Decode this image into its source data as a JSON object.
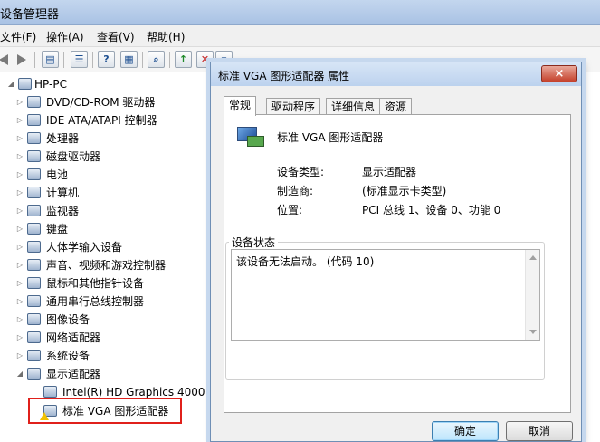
{
  "window": {
    "title": "设备管理器"
  },
  "menu": [
    "文件(F)",
    "操作(A)",
    "查看(V)",
    "帮助(H)"
  ],
  "tree": {
    "root": "HP-PC",
    "items": [
      {
        "label": "DVD/CD-ROM 驱动器",
        "expanded": false
      },
      {
        "label": "IDE ATA/ATAPI 控制器",
        "expanded": false
      },
      {
        "label": "处理器",
        "expanded": false
      },
      {
        "label": "磁盘驱动器",
        "expanded": false
      },
      {
        "label": "电池",
        "expanded": false
      },
      {
        "label": "计算机",
        "expanded": false
      },
      {
        "label": "监视器",
        "expanded": false
      },
      {
        "label": "键盘",
        "expanded": false
      },
      {
        "label": "人体学输入设备",
        "expanded": false
      },
      {
        "label": "声音、视频和游戏控制器",
        "expanded": false
      },
      {
        "label": "鼠标和其他指针设备",
        "expanded": false
      },
      {
        "label": "通用串行总线控制器",
        "expanded": false
      },
      {
        "label": "图像设备",
        "expanded": false
      },
      {
        "label": "网络适配器",
        "expanded": false
      },
      {
        "label": "系统设备",
        "expanded": false
      },
      {
        "label": "显示适配器",
        "expanded": true
      }
    ],
    "children": [
      "Intel(R) HD Graphics 4000",
      "标准 VGA 图形适配器"
    ]
  },
  "dialog": {
    "title": "标准 VGA 图形适配器 属性",
    "close_glyph": "×",
    "tabs": [
      "常规",
      "驱动程序",
      "详细信息",
      "资源"
    ],
    "device_name": "标准 VGA 图形适配器",
    "props": {
      "type_label": "设备类型:",
      "type_value": "显示适配器",
      "mfr_label": "制造商:",
      "mfr_value": "(标准显示卡类型)",
      "loc_label": "位置:",
      "loc_value": "PCI 总线 1、设备 0、功能 0"
    },
    "status_caption": "设备状态",
    "status_text": "该设备无法启动。 (代码 10)",
    "ok": "确定",
    "cancel": "取消"
  },
  "colors": {
    "highlight_box": "#e0201b",
    "title_bar": "#bcd2ee",
    "warning": "#f2c200"
  }
}
